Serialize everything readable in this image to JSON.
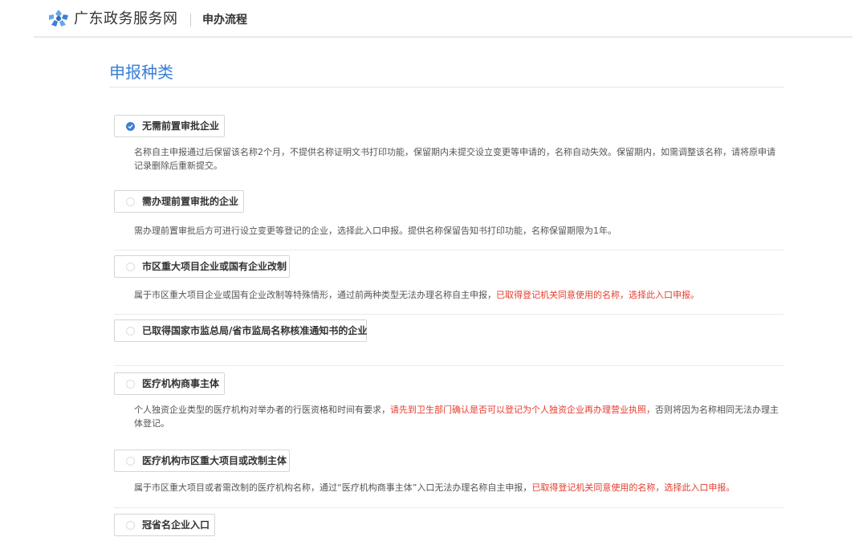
{
  "header": {
    "logo_text": "广东政务服务网",
    "crumb": "申办流程"
  },
  "section": {
    "title": "申报种类"
  },
  "options": [
    {
      "label": "无需前置审批企业",
      "selected": true,
      "desc": "名称自主申报通过后保留该名称2个月，不提供名称证明文书打印功能，保留期内未提交设立变更等申请的，名称自动失效。保留期内，如需调整该名称，请将原申请记录删除后重新提交。"
    },
    {
      "label": "需办理前置审批的企业",
      "selected": false,
      "desc": "需办理前置审批后方可进行设立变更等登记的企业，选择此入口申报。提供名称保留告知书打印功能，名称保留期限为1年。"
    },
    {
      "label": "市区重大项目企业或国有企业改制",
      "selected": false,
      "desc_before": "属于市区重大项目企业或国有企业改制等特殊情形，通过前两种类型无法办理名称自主申报，",
      "desc_red": "已取得登记机关同意使用的名称，选择此入口申报。"
    },
    {
      "label": "已取得国家市监总局/省市监局名称核准通知书的企业",
      "selected": false
    },
    {
      "label": "医疗机构商事主体",
      "selected": false,
      "desc_before": "个人独资企业类型的医疗机构对举办者的行医资格和时间有要求，",
      "desc_red": "请先到卫生部门确认是否可以登记为个人独资企业再办理营业执照，",
      "desc_after": "否则将因为名称相同无法办理主体登记。"
    },
    {
      "label": "医疗机构市区重大项目或改制主体",
      "selected": false,
      "desc_before": "属于市区重大项目或者需改制的医疗机构名称，通过“医疗机构商事主体”入口无法办理名称自主申报，",
      "desc_red": "已取得登记机关同意使用的名称，选择此入口申报。"
    },
    {
      "label": "冠省名企业入口",
      "selected": false
    }
  ],
  "colors": {
    "accent": "#3a7fd5",
    "warning_text": "#e63d2e"
  }
}
